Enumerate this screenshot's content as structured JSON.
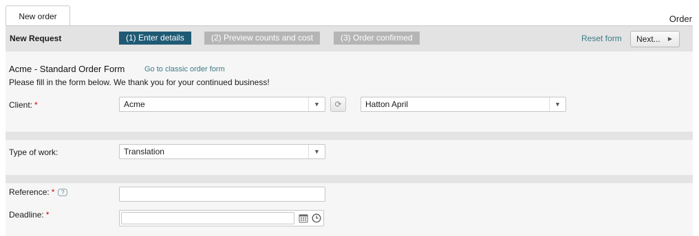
{
  "tab": {
    "label": "New order",
    "right_label": "Order"
  },
  "wizard": {
    "title": "New Request",
    "steps": [
      {
        "label": "(1) Enter details"
      },
      {
        "label": "(2) Preview counts and cost"
      },
      {
        "label": "(3) Order confirmed"
      }
    ],
    "reset_label": "Reset form",
    "next_label": "Next...",
    "colors": {
      "active_step": "#1f5a74",
      "inactive_step": "#b5b5b5"
    }
  },
  "form": {
    "title": "Acme - Standard Order Form",
    "classic_link": "Go to classic order form",
    "intro": "Please fill in the form below. We thank you for your continued business!",
    "client": {
      "label": "Client:",
      "required": "*",
      "value": "Acme",
      "contact_value": "Hatton April"
    },
    "work_type": {
      "label": "Type of work:",
      "value": "Translation"
    },
    "reference": {
      "label": "Reference:",
      "required": "*",
      "value": "",
      "help": "?"
    },
    "deadline": {
      "label": "Deadline:",
      "required": "*",
      "value": ""
    }
  },
  "icons": [
    "caret-down-icon",
    "refresh-icon",
    "help-icon",
    "calendar-icon",
    "clock-icon",
    "arrow-right-icon"
  ]
}
